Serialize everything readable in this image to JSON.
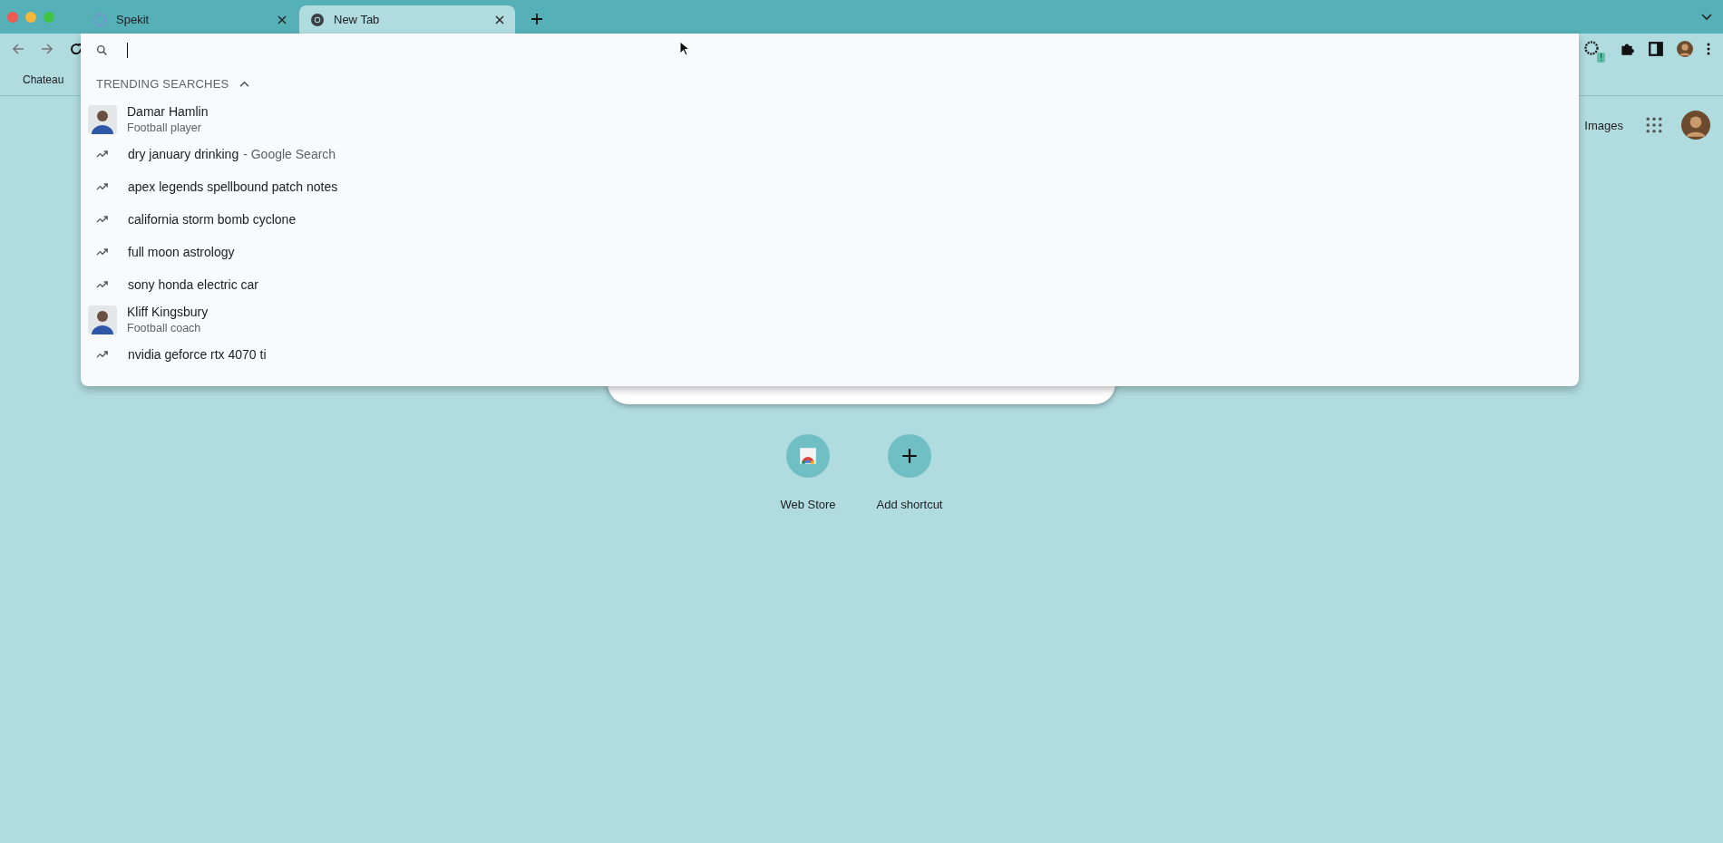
{
  "tabs": [
    {
      "label": "Spekit",
      "selected": false,
      "kind": "site"
    },
    {
      "label": "New Tab",
      "selected": true,
      "kind": "chrome"
    }
  ],
  "toolbar": {
    "extension_badge": "!"
  },
  "bookmarks": [
    "Chateau"
  ],
  "dropdown": {
    "heading": "TRENDING SEARCHES",
    "expanded": true,
    "suggestions": [
      {
        "kind": "entity",
        "title": "Damar Hamlin",
        "subtitle": "Football player"
      },
      {
        "kind": "trend",
        "title": "dry january drinking",
        "suffix": "- Google Search"
      },
      {
        "kind": "trend",
        "title": "apex legends spellbound patch notes"
      },
      {
        "kind": "trend",
        "title": "california storm bomb cyclone"
      },
      {
        "kind": "trend",
        "title": "full moon astrology"
      },
      {
        "kind": "trend",
        "title": "sony honda electric car"
      },
      {
        "kind": "entity",
        "title": "Kliff Kingsbury",
        "subtitle": "Football coach"
      },
      {
        "kind": "trend",
        "title": "nvidia geforce rtx 4070 ti"
      }
    ]
  },
  "page": {
    "header_link": "Images",
    "shortcuts": [
      {
        "kind": "store",
        "label": "Web Store"
      },
      {
        "kind": "add",
        "label": "Add shortcut"
      }
    ]
  }
}
